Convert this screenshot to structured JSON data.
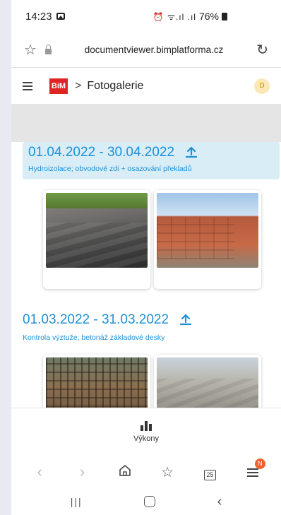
{
  "status_bar": {
    "time": "14:23",
    "right_symbols": "⏰ ᯤ.ıl .ıl",
    "battery": "76%"
  },
  "browser": {
    "url": "documentviewer.bimplatforma.cz"
  },
  "app_header": {
    "logo_text": "BiM",
    "separator": ">",
    "title": "Fotogalerie",
    "avatar_initial": "D"
  },
  "sections": [
    {
      "date_range": "01.04.2022 - 30.04.2022",
      "description": "Hydroizolace; obvodové zdi + osazování překladů"
    },
    {
      "date_range": "01.03.2022 - 31.03.2022",
      "description": "Kontrola výztuže, betonáž základové desky"
    }
  ],
  "bottom_nav": {
    "label": "Výkony"
  },
  "toolbar": {
    "tabs_count": "25",
    "notification_badge": "N"
  },
  "colors": {
    "accent": "#1e90d6",
    "highlight_bg": "#d9edf7",
    "brand_red": "#e02424",
    "badge_orange": "#f0622b"
  }
}
